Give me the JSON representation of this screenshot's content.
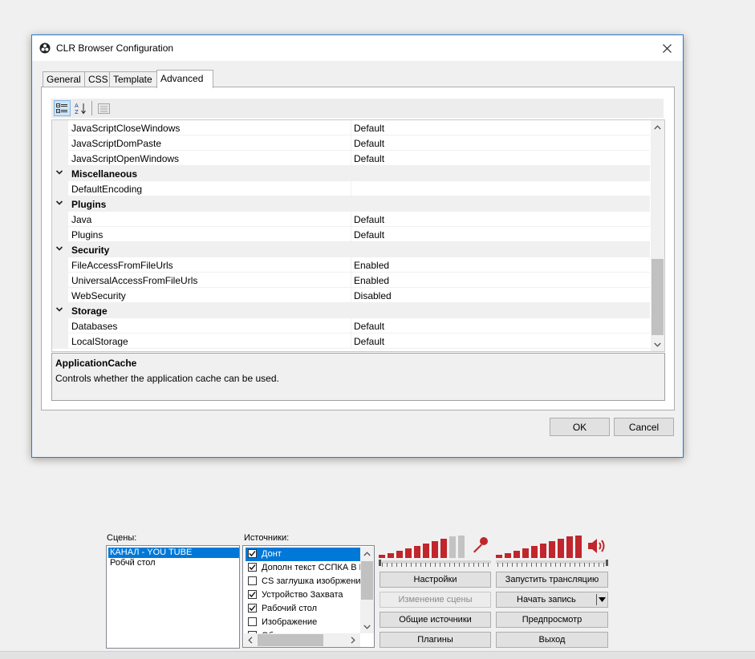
{
  "dialog": {
    "title": "CLR Browser Configuration",
    "tabs": [
      {
        "label": "General"
      },
      {
        "label": "CSS"
      },
      {
        "label": "Template"
      },
      {
        "label": "Advanced"
      }
    ],
    "active_tab": "Advanced",
    "toolbar": {
      "categorized_icon": "categorized-icon",
      "alphabetical_icon": "alphabetical-icon",
      "property_pages_icon": "property-pages-icon"
    },
    "properties": [
      {
        "name": "JavaScriptCloseWindows",
        "value": "Default"
      },
      {
        "name": "JavaScriptDomPaste",
        "value": "Default"
      },
      {
        "name": "JavaScriptOpenWindows",
        "value": "Default"
      },
      {
        "category": "Miscellaneous"
      },
      {
        "name": "DefaultEncoding",
        "value": ""
      },
      {
        "category": "Plugins"
      },
      {
        "name": "Java",
        "value": "Default"
      },
      {
        "name": "Plugins",
        "value": "Default"
      },
      {
        "category": "Security"
      },
      {
        "name": "FileAccessFromFileUrls",
        "value": "Enabled"
      },
      {
        "name": "UniversalAccessFromFileUrls",
        "value": "Enabled"
      },
      {
        "name": "WebSecurity",
        "value": "Disabled"
      },
      {
        "category": "Storage"
      },
      {
        "name": "Databases",
        "value": "Default"
      },
      {
        "name": "LocalStorage",
        "value": "Default"
      }
    ],
    "help": {
      "title": "ApplicationCache",
      "description": "Controls whether the application cache can be used."
    },
    "ok_label": "OK",
    "cancel_label": "Cancel"
  },
  "obs": {
    "scenes_label": "Сцены:",
    "scenes": [
      {
        "label": "КАНАЛ - YOU TUBE",
        "selected": true
      },
      {
        "label": "Робчй стол",
        "selected": false
      }
    ],
    "sources_label": "Источники:",
    "sources": [
      {
        "label": "Донт",
        "checked": true,
        "selected": true
      },
      {
        "label": "Дополн текст ССПКА В ПР",
        "checked": true,
        "selected": false
      },
      {
        "label": "CS заглушка изобржение",
        "checked": false,
        "selected": false
      },
      {
        "label": "Устройство Захвата",
        "checked": true,
        "selected": false
      },
      {
        "label": "Рабочий стол",
        "checked": true,
        "selected": false
      },
      {
        "label": "Изображение",
        "checked": false,
        "selected": false
      },
      {
        "label": "Об",
        "checked": false,
        "selected": false
      }
    ],
    "mic_icon": "microphone-icon",
    "speaker_icon": "speaker-icon",
    "mic_level": 0.8,
    "desktop_level": 1.0,
    "buttons": {
      "settings": "Настройки",
      "start_stream": "Запустить трансляцию",
      "edit_scene": "Изменение сцены",
      "start_record": "Начать запись",
      "global_sources": "Общие источники",
      "preview": "Предпросмотр",
      "plugins": "Плагины",
      "exit": "Выход"
    },
    "accent_red": "#c0262b"
  }
}
